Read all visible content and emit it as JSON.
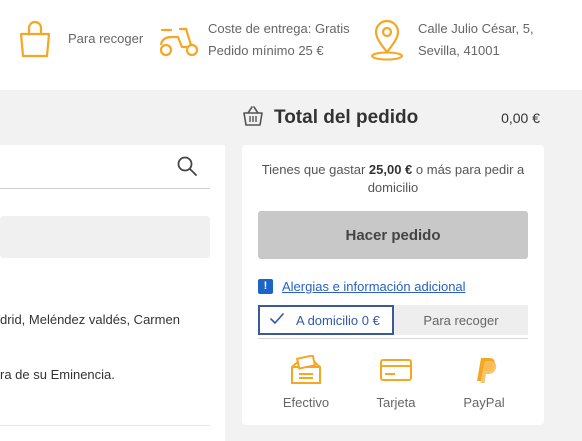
{
  "header": {
    "pickup_label": "Para recoger",
    "delivery_cost": "Coste de entrega: Gratis",
    "min_order": "Pedido mínimo 25 €",
    "address_line1": "Calle Julio César, 5,",
    "address_line2": "Sevilla, 41001"
  },
  "menu_panel": {
    "text_line1": "drid, Meléndez valdés, Carmen",
    "text_line2": "ra de su Eminencia."
  },
  "order": {
    "title": "Total del pedido",
    "total": "0,00 €",
    "min_msg_prefix": "Tienes que gastar ",
    "min_msg_amount": "25,00 €",
    "min_msg_suffix": " o más para pedir a domicilio",
    "order_button": "Hacer pedido",
    "allergy_link": "Alergias e información adicional",
    "delivery_option": "A domicilio 0 €",
    "pickup_option": "Para recoger",
    "payment_methods": [
      {
        "label": "Efectivo",
        "icon": "cash-icon"
      },
      {
        "label": "Tarjeta",
        "icon": "card-icon"
      },
      {
        "label": "PayPal",
        "icon": "paypal-icon"
      }
    ]
  },
  "colors": {
    "accent_orange": "#f5a623",
    "link_blue": "#2860c4",
    "selected_border": "#3a5a9c"
  }
}
